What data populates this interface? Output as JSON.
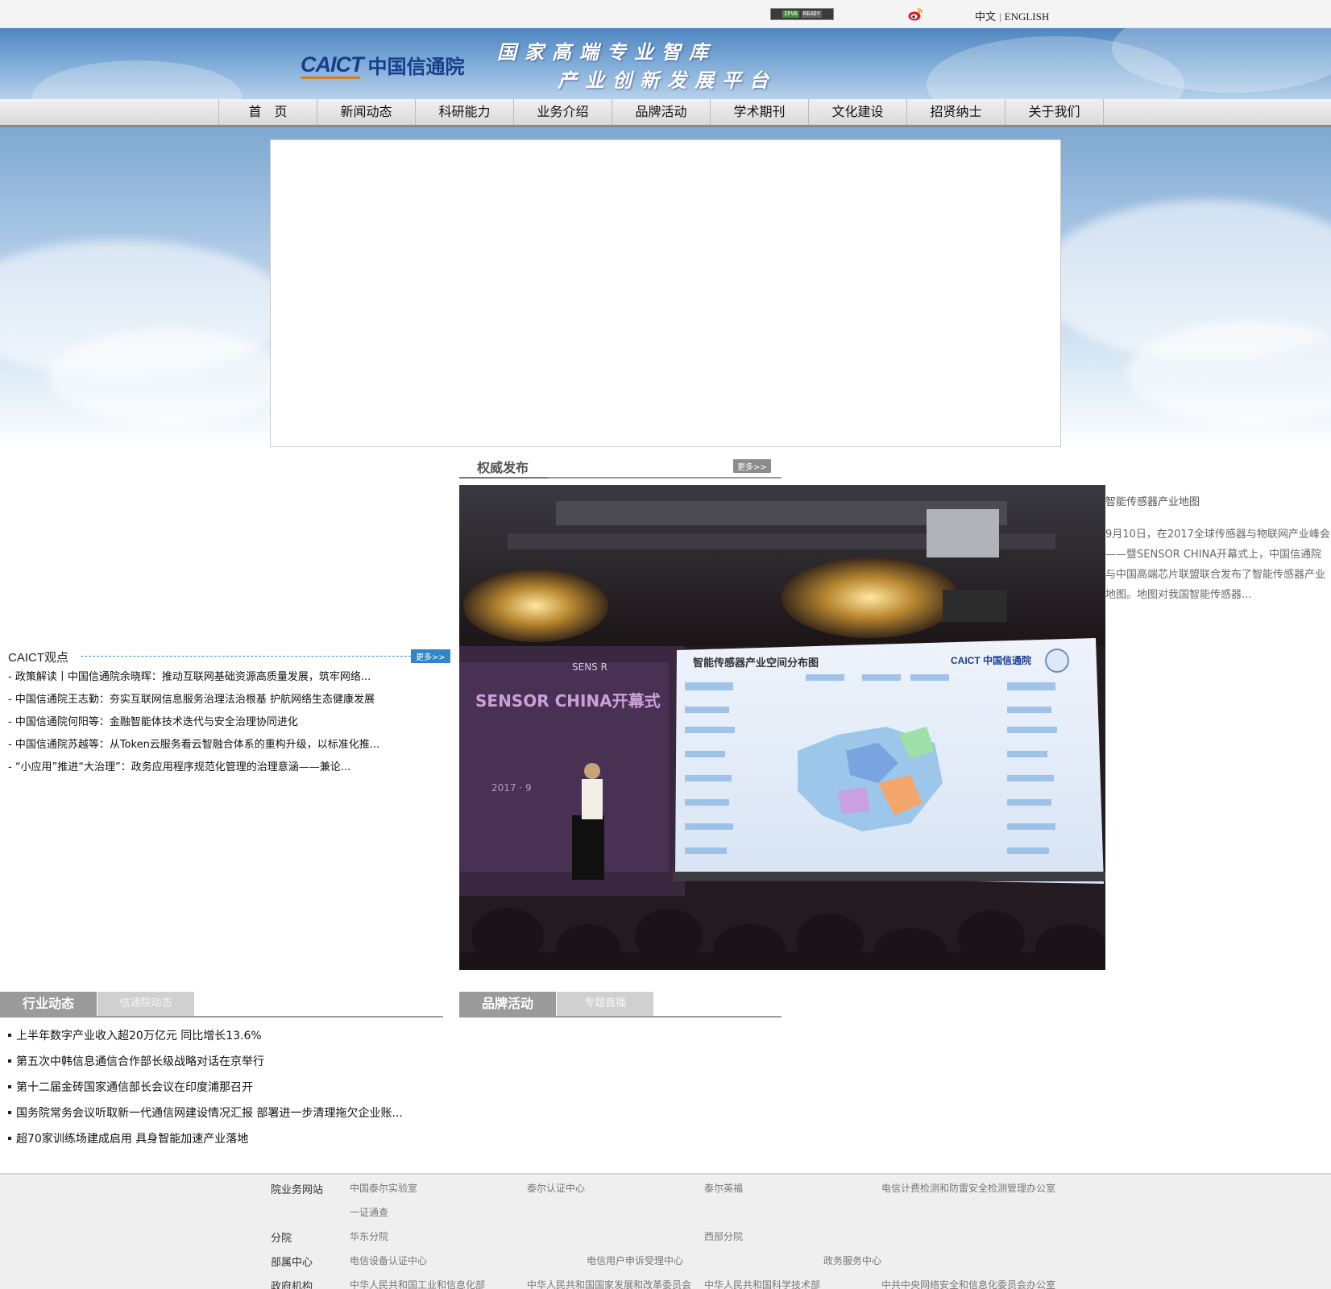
{
  "topbar": {
    "ipv6_badge_left": "IPV6",
    "ipv6_badge_right": "READY",
    "lang_cn": "中文",
    "lang_sep": "|",
    "lang_en": "ENGLISH"
  },
  "header": {
    "logo_en": "CAICT",
    "logo_cn": "中国信通院",
    "slogan_line1": "国家高端专业智库",
    "slogan_line2": "产业创新发展平台"
  },
  "nav": {
    "items": [
      "首　页",
      "新闻动态",
      "科研能力",
      "业务介绍",
      "品牌活动",
      "学术期刊",
      "文化建设",
      "招贤纳士",
      "关于我们"
    ]
  },
  "authority": {
    "title": "权威发布",
    "more": "更多>>",
    "feature_title": "智能传感器产业地图",
    "feature_summary": "9月10日，在2017全球传感器与物联网产业峰会——暨SENSOR CHINA开幕式上，中国信通院与中国高端芯片联盟联合发布了智能传感器产业地图。地图对我国智能传感器...",
    "photo": {
      "slide_title": "智能传感器产业空间分布图",
      "slide_logo": "CAICT 中国信通院",
      "backdrop_text": "SENSOR CHINA开幕式",
      "backdrop_brand": "SENS R",
      "backdrop_date": "2017 · 9"
    }
  },
  "viewpoints": {
    "title": "CAICT观点",
    "more": "更多>>",
    "items": [
      "- 政策解读丨中国信通院余晓晖：推动互联网基础资源高质量发展，筑牢网络...",
      "- 中国信通院王志勤：夯实互联网信息服务治理法治根基 护航网络生态健康发展",
      "- 中国信通院何阳等：金融智能体技术迭代与安全治理协同进化",
      "- 中国信通院苏越等：从Token云服务看云智融合体系的重构升级，以标准化推...",
      "- “小应用”推进“大治理”：政务应用程序规范化管理的治理意涵——兼论..."
    ]
  },
  "industry_news": {
    "tab_active": "行业动态",
    "tab_inactive": "信通院动态",
    "items": [
      "上半年数字产业收入超20万亿元 同比增长13.6%",
      "第五次中韩信息通信合作部长级战略对话在京举行",
      "第十二届金砖国家通信部长会议在印度浦那召开",
      "国务院常务会议听取新一代通信网建设情况汇报 部署进一步清理拖欠企业账...",
      "超70家训练场建成启用 具身智能加速产业落地"
    ]
  },
  "brand": {
    "tab_active": "品牌活动",
    "tab_inactive": "专题直播"
  },
  "footer": {
    "rows": [
      {
        "label": "院业务网站",
        "links": [
          "中国泰尔实验室",
          "泰尔认证中心",
          "泰尔英福",
          "电信计费检测和防雷安全检测管理办公室"
        ]
      },
      {
        "label": "",
        "links": [
          "一证通查"
        ]
      },
      {
        "label": "分院",
        "links": [
          "华东分院",
          "西部分院"
        ]
      },
      {
        "label": "部属中心",
        "links": [
          "电信设备认证中心",
          "电信用户申诉受理中心",
          "政务服务中心"
        ]
      },
      {
        "label": "政府机构",
        "links": [
          "中华人民共和国工业和信息化部",
          "中华人民共和国国家发展和改革委员会",
          "中华人民共和国科学技术部",
          "中共中央网络安全和信息化委员会办公室"
        ]
      }
    ]
  },
  "colors": {
    "banner_blue": "#4f86c0",
    "more_blue": "#2f86c8",
    "tab_gray": "#9b9b9b"
  }
}
